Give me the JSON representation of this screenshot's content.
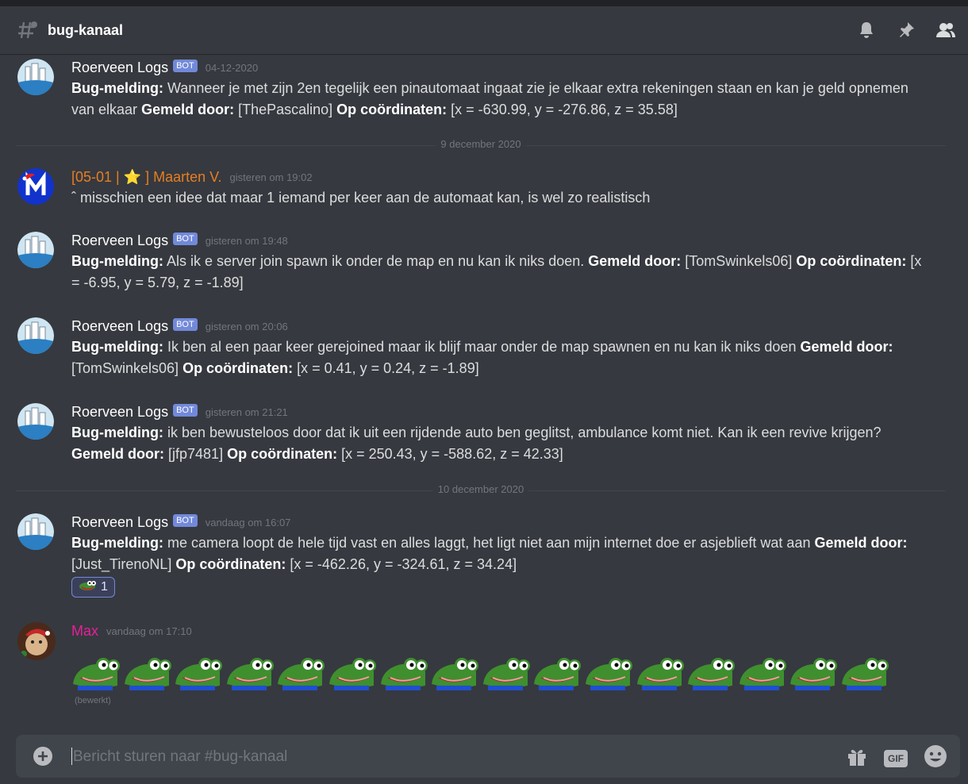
{
  "channel": {
    "name": "bug-kanaal"
  },
  "messages": [
    {
      "author": "Roerveen Logs",
      "bot_tag": "BOT",
      "timestamp": "04-12-2020",
      "lines": [
        "Bug-melding:",
        " Wanneer je met zijn 2en tegelijk een pinautomaat ingaat zie je elkaar extra rekeningen staan en kan je geld opnemen van elkaar ",
        "Gemeld door:",
        " [ThePascalino] ",
        "Op coördinaten:",
        " [x = -630.99, y = -276.86, z = 35.58]"
      ]
    },
    {
      "author": "[05-01 | ⭐ ] Maarten V.",
      "author_color": "#e67e22",
      "timestamp": "gisteren om 19:02",
      "text": "ˆ misschien een idee dat maar 1 iemand per keer aan de automaat kan, is wel zo realistisch"
    },
    {
      "author": "Roerveen Logs",
      "bot_tag": "BOT",
      "timestamp": "gisteren om 19:48",
      "lines": [
        "Bug-melding:",
        " Als ik e server join spawn ik onder de map en nu kan ik niks doen. ",
        "Gemeld door:",
        " [TomSwinkels06] ",
        "Op coördinaten:",
        " [x = -6.95, y = 5.79, z = -1.89]"
      ]
    },
    {
      "author": "Roerveen Logs",
      "bot_tag": "BOT",
      "timestamp": "gisteren om 20:06",
      "lines": [
        "Bug-melding:",
        " Ik ben al een paar keer gerejoined maar ik blijf maar onder de map spawnen en nu kan ik niks doen ",
        "Gemeld door:",
        " [TomSwinkels06] ",
        "Op coördinaten:",
        " [x = 0.41, y = 0.24, z = -1.89]"
      ]
    },
    {
      "author": "Roerveen Logs",
      "bot_tag": "BOT",
      "timestamp": "gisteren om 21:21",
      "lines": [
        "Bug-melding:",
        " ik ben bewusteloos door dat ik uit een rijdende auto ben geglitst, ambulance komt niet. Kan ik een revive krijgen? ",
        "Gemeld door:",
        " [jfp7481] ",
        "Op coördinaten:",
        " [x = 250.43, y = -588.62, z = 42.33]"
      ]
    },
    {
      "author": "Roerveen Logs",
      "bot_tag": "BOT",
      "timestamp": "vandaag om 16:07",
      "lines": [
        "Bug-melding:",
        " me camera loopt de hele tijd vast en alles laggt, het ligt niet aan mijn internet doe er asjeblieft wat aan ",
        "Gemeld door:",
        " [Just_TirenoNL] ",
        "Op coördinaten:",
        " [x = -462.26, y = -324.61, z = 34.24]"
      ],
      "reaction": {
        "emoji": "frog-emote",
        "count": "1"
      }
    },
    {
      "author": "Max",
      "author_color": "#e91e9c",
      "timestamp": "vandaag om 17:10",
      "emote_count": 16,
      "emote": "pepe-frog-emote",
      "edited": "(bewerkt)"
    }
  ],
  "dividers": [
    "9 december 2020",
    "10 december 2020"
  ],
  "composer": {
    "placeholder": "Bericht sturen naar #bug-kanaal",
    "gif_label": "GIF"
  },
  "colors": {
    "bg": "#36393f",
    "bot": "#7289da",
    "composer": "#40444b"
  }
}
